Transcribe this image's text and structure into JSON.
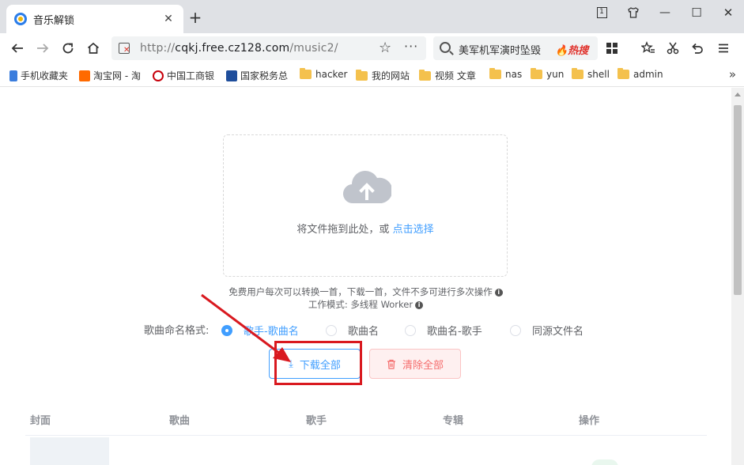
{
  "tab": {
    "title": "音乐解锁",
    "close": "✕",
    "new_tab": "+"
  },
  "window": {
    "restore_badge": "1",
    "minimize": "—",
    "maximize": "☐",
    "close": "✕"
  },
  "address": {
    "prefix": "http://",
    "host": "cqkj.free.cz128.com",
    "path": "/music2/"
  },
  "search": {
    "query": "美军机军演时坠毁",
    "hot_label": "🔥热搜"
  },
  "bookmarks": [
    {
      "label": "手机收藏夹"
    },
    {
      "label": "淘宝网 - 淘"
    },
    {
      "label": "中国工商银"
    },
    {
      "label": "国家税务总"
    },
    {
      "label": "hacker"
    },
    {
      "label": "我的网站"
    },
    {
      "label": "视频 文章"
    },
    {
      "label": "nas"
    },
    {
      "label": "yun"
    },
    {
      "label": "shell"
    },
    {
      "label": "admin"
    }
  ],
  "bookmarks_more": "»",
  "upload": {
    "text": "将文件拖到此处，或 ",
    "link": "点击选择"
  },
  "tips": {
    "line1": "免费用户每次可以转换一首，下载一首，文件不多可进行多次操作",
    "line2": "工作模式: 多线程 Worker",
    "info_glyph": "i"
  },
  "naming": {
    "label": "歌曲命名格式:",
    "options": [
      {
        "label": "歌手-歌曲名",
        "selected": true
      },
      {
        "label": "歌曲名",
        "selected": false
      },
      {
        "label": "歌曲名-歌手",
        "selected": false
      },
      {
        "label": "同源文件名",
        "selected": false
      }
    ]
  },
  "buttons": {
    "download_all": "下载全部",
    "download_icon": "⤓",
    "clear_all": "清除全部",
    "clear_icon": "🗑"
  },
  "table": {
    "headers": [
      "封面",
      "歌曲",
      "歌手",
      "专辑",
      "操作"
    ]
  },
  "colors": {
    "primary": "#409eff",
    "danger": "#f56c6c",
    "annotation_red": "#d9191f",
    "hot_red": "#e0312b"
  }
}
